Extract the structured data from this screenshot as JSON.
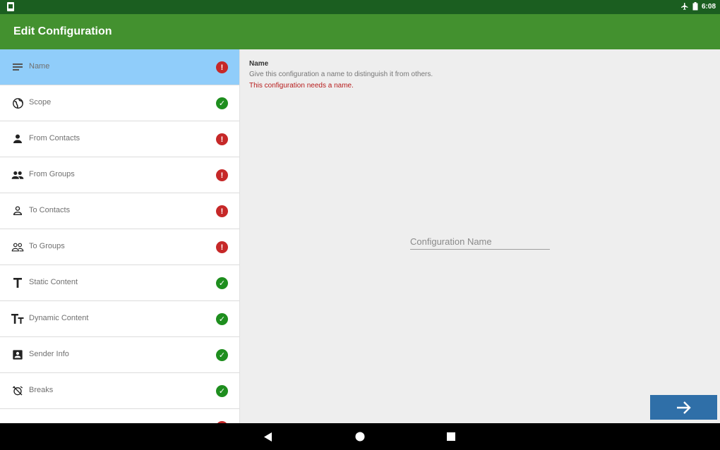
{
  "status_bar": {
    "time": "6:08"
  },
  "app_bar": {
    "title": "Edit Configuration"
  },
  "sidebar": {
    "items": [
      {
        "label": "Name",
        "icon": "subject-icon",
        "status": "error",
        "selected": true
      },
      {
        "label": "Scope",
        "icon": "globe-icon",
        "status": "ok"
      },
      {
        "label": "From Contacts",
        "icon": "person-icon",
        "status": "error"
      },
      {
        "label": "From Groups",
        "icon": "people-icon",
        "status": "error"
      },
      {
        "label": "To Contacts",
        "icon": "person-outline-icon",
        "status": "error"
      },
      {
        "label": "To Groups",
        "icon": "people-outline-icon",
        "status": "error"
      },
      {
        "label": "Static Content",
        "icon": "text-icon",
        "status": "ok"
      },
      {
        "label": "Dynamic Content",
        "icon": "text-size-icon",
        "status": "ok"
      },
      {
        "label": "Sender Info",
        "icon": "contact-card-icon",
        "status": "ok"
      },
      {
        "label": "Breaks",
        "icon": "alarm-off-icon",
        "status": "ok"
      }
    ]
  },
  "main": {
    "heading": "Name",
    "description": "Give this configuration a name to distinguish it from others.",
    "error": "This configuration needs a name.",
    "name_field": {
      "placeholder": "Configuration Name",
      "value": ""
    }
  },
  "colors": {
    "status_bar": "#1b5e20",
    "app_bar": "#43912f",
    "selected_item": "#90cdfa",
    "error": "#c62828",
    "ok": "#1e8e1e",
    "next_button": "#2f6fa8"
  }
}
